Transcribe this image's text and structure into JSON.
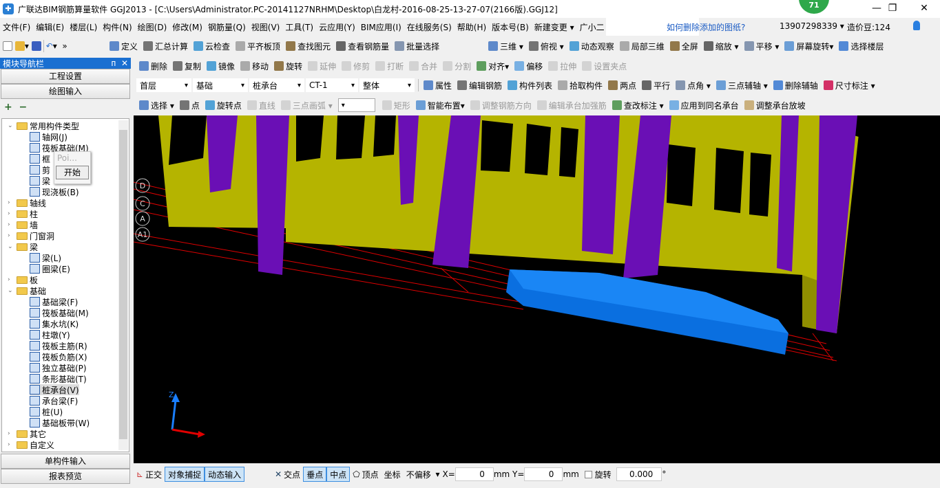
{
  "window": {
    "title": "广联达BIM钢筋算量软件 GGJ2013 - [C:\\Users\\Administrator.PC-20141127NRHM\\Desktop\\白龙村-2016-08-25-13-27-07(2166版).GGJ12]",
    "badge": "71",
    "minimize": "—",
    "restore": "❐",
    "close": "✕"
  },
  "menu": [
    "文件(F)",
    "编辑(E)",
    "楼层(L)",
    "构件(N)",
    "绘图(D)",
    "修改(M)",
    "钢筋量(Q)",
    "视图(V)",
    "工具(T)",
    "云应用(Y)",
    "BIM应用(I)",
    "在线服务(S)",
    "帮助(H)",
    "版本号(B)",
    "新建变更 ▾",
    "广小二"
  ],
  "hint_link": "如何删除添加的图纸?",
  "account": {
    "phone": "13907298339 ▾",
    "beans": "造价豆:124"
  },
  "toolbar1": [
    "定义",
    "汇总计算",
    "云检查",
    "平齐板顶",
    "查找图元",
    "查看钢筋量",
    "批量选择"
  ],
  "toolbar1_right": [
    "三维 ▾",
    "俯视 ▾",
    "动态观察",
    "局部三维",
    "全屏",
    "缩放 ▾",
    "平移 ▾",
    "屏幕旋转▾",
    "选择楼层"
  ],
  "toolbar2": [
    "删除",
    "复制",
    "镜像",
    "移动",
    "旋转",
    "延伸",
    "修剪",
    "打断",
    "合并",
    "分割",
    "对齐▾",
    "偏移",
    "拉伸",
    "设置夹点"
  ],
  "toolbar2_disabled": [
    false,
    false,
    false,
    false,
    false,
    true,
    true,
    true,
    true,
    true,
    false,
    false,
    true,
    true
  ],
  "selectors": [
    "首层",
    "基础",
    "桩承台",
    "CT-1",
    "整体"
  ],
  "toolbar3": [
    "属性",
    "编辑钢筋",
    "构件列表",
    "拾取构件",
    "两点",
    "平行",
    "点角 ▾",
    "三点辅轴 ▾",
    "删除辅轴",
    "尺寸标注 ▾"
  ],
  "toolbar4": [
    "选择 ▾",
    "点",
    "旋转点",
    "直线",
    "三点画弧 ▾",
    "",
    "矩形",
    "智能布置▾",
    "调整钢筋方向",
    "编辑承台加强筋",
    "查改标注 ▾",
    "应用到同名承台",
    "调整承台放坡"
  ],
  "toolbar4_disabled": [
    false,
    false,
    false,
    true,
    true,
    false,
    true,
    false,
    true,
    true,
    false,
    false,
    false
  ],
  "nav": {
    "title": "模块导航栏",
    "pin": "ᴨ",
    "close": "✕",
    "project_settings": "工程设置",
    "drawing_input": "绘图输入",
    "single_input": "单构件输入",
    "report_preview": "报表预览",
    "expand": "+",
    "collapse": "−"
  },
  "tree": [
    {
      "label": "常用构件类型",
      "level": 0,
      "type": "folder",
      "open": true
    },
    {
      "label": "轴网(J)",
      "level": 1
    },
    {
      "label": "筏板基础(M)",
      "level": 1
    },
    {
      "label": "框",
      "level": 1
    },
    {
      "label": "剪",
      "level": 1
    },
    {
      "label": "梁",
      "level": 1
    },
    {
      "label": "现浇板(B)",
      "level": 1
    },
    {
      "label": "轴线",
      "level": 0,
      "type": "folder"
    },
    {
      "label": "柱",
      "level": 0,
      "type": "folder"
    },
    {
      "label": "墙",
      "level": 0,
      "type": "folder"
    },
    {
      "label": "门窗洞",
      "level": 0,
      "type": "folder"
    },
    {
      "label": "梁",
      "level": 0,
      "type": "folder",
      "open": true
    },
    {
      "label": "梁(L)",
      "level": 1
    },
    {
      "label": "圈梁(E)",
      "level": 1
    },
    {
      "label": "板",
      "level": 0,
      "type": "folder"
    },
    {
      "label": "基础",
      "level": 0,
      "type": "folder",
      "open": true
    },
    {
      "label": "基础梁(F)",
      "level": 1
    },
    {
      "label": "筏板基础(M)",
      "level": 1
    },
    {
      "label": "集水坑(K)",
      "level": 1
    },
    {
      "label": "柱墩(Y)",
      "level": 1
    },
    {
      "label": "筏板主筋(R)",
      "level": 1
    },
    {
      "label": "筏板负筋(X)",
      "level": 1
    },
    {
      "label": "独立基础(P)",
      "level": 1
    },
    {
      "label": "条形基础(T)",
      "level": 1
    },
    {
      "label": "桩承台(V)",
      "level": 1,
      "selected": true
    },
    {
      "label": "承台梁(F)",
      "level": 1
    },
    {
      "label": "桩(U)",
      "level": 1
    },
    {
      "label": "基础板带(W)",
      "level": 1
    },
    {
      "label": "其它",
      "level": 0,
      "type": "folder"
    },
    {
      "label": "自定义",
      "level": 0,
      "type": "folder"
    }
  ],
  "popup": {
    "title": "Poi...",
    "button": "开始"
  },
  "axis_labels": [
    "D",
    "C",
    "A",
    "A1"
  ],
  "viewport_axis": {
    "z": "Z"
  },
  "statusbar": {
    "ortho": "正交",
    "snap": "对象捕捉",
    "dynamic": "动态输入",
    "intersection": "交点",
    "perpendicular": "垂点",
    "midpoint": "中点",
    "vertex": "顶点",
    "coord": "坐标",
    "offset": "不偏移",
    "x_label": "X=",
    "x_value": "0",
    "unit": "mm",
    "y_label": "Y=",
    "y_value": "0",
    "rotate": "旋转",
    "rotate_value": "0.000",
    "degree": "°"
  },
  "colors": {
    "wall": "#b5b400",
    "column": "#6a0fb5",
    "pile_cap": "#0a6fe0",
    "grid_line": "#e00000",
    "nav_header": "#1a6fd1"
  }
}
